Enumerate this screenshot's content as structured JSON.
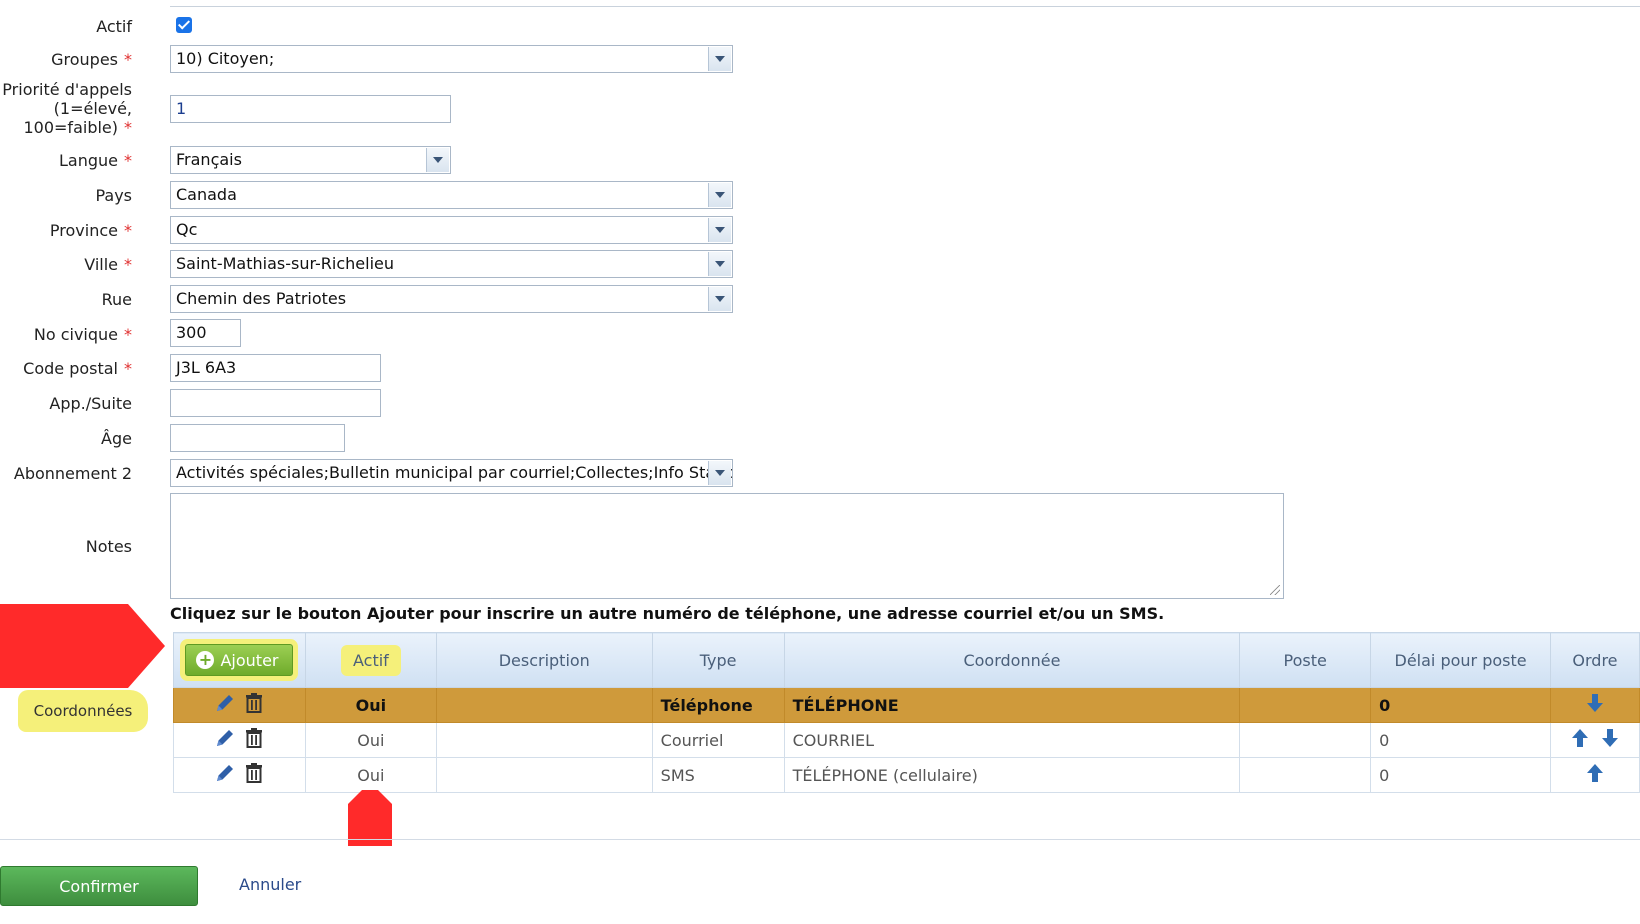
{
  "form": {
    "actif": {
      "label": "Actif",
      "checked": true
    },
    "groupes": {
      "label": "Groupes",
      "value": "10) Citoyen;"
    },
    "priorite": {
      "label": "Priorité d'appels (1=élevé, 100=faible)",
      "line1": "Priorité d'appels",
      "line2": "(1=élevé,",
      "line3": "100=faible)",
      "value": "1"
    },
    "langue": {
      "label": "Langue",
      "value": "Français"
    },
    "pays": {
      "label": "Pays",
      "value": "Canada"
    },
    "province": {
      "label": "Province",
      "value": "Qc"
    },
    "ville": {
      "label": "Ville",
      "value": "Saint-Mathias-sur-Richelieu"
    },
    "rue": {
      "label": "Rue",
      "value": "Chemin des Patriotes"
    },
    "no_civique": {
      "label": "No civique",
      "value": "300"
    },
    "code_postal": {
      "label": "Code postal",
      "value": "J3L 6A3"
    },
    "app_suite": {
      "label": "App./Suite",
      "value": ""
    },
    "age": {
      "label": "Âge",
      "value": ""
    },
    "abonnement": {
      "label": "Abonnement 2",
      "value": "Activités spéciales;Bulletin municipal par courriel;Collectes;Info Stationi"
    },
    "notes": {
      "label": "Notes",
      "value": ""
    },
    "required_mark": "*"
  },
  "coordonnees": {
    "instruction": "Cliquez sur le bouton Ajouter pour inscrire un autre numéro de téléphone, une adresse courriel et/ou un SMS.",
    "annotation_label": "Coordonnées",
    "add_button": "Ajouter",
    "columns": [
      "Actif",
      "Description",
      "Type",
      "Coordonnée",
      "Poste",
      "Délai pour poste",
      "Ordre"
    ],
    "rows": [
      {
        "actif": "Oui",
        "description": "",
        "type": "Téléphone",
        "coordonnee": "TÉLÉPHONE",
        "poste": "",
        "delai": "0",
        "order": [
          "down"
        ],
        "selected": true
      },
      {
        "actif": "Oui",
        "description": "",
        "type": "Courriel",
        "coordonnee": "COURRIEL",
        "poste": "",
        "delai": "0",
        "order": [
          "up",
          "down"
        ],
        "selected": false
      },
      {
        "actif": "Oui",
        "description": "",
        "type": "SMS",
        "coordonnee": "TÉLÉPHONE (cellulaire)",
        "poste": "",
        "delai": "0",
        "order": [
          "up"
        ],
        "selected": false
      }
    ]
  },
  "actions": {
    "confirm": "Confirmer",
    "cancel": "Annuler"
  },
  "colors": {
    "accent": "#1a73e8",
    "selected_row": "#cf9a3b",
    "annotation_red": "#ff2a2a",
    "highlight_yellow": "#f5f07a",
    "confirm_green": "#4aa34a"
  }
}
